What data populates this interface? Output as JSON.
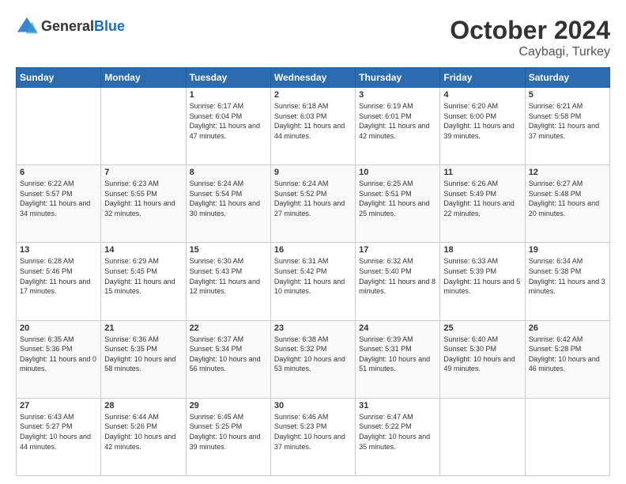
{
  "header": {
    "logo_general": "General",
    "logo_blue": "Blue",
    "month": "October 2024",
    "location": "Caybagi, Turkey"
  },
  "weekdays": [
    "Sunday",
    "Monday",
    "Tuesday",
    "Wednesday",
    "Thursday",
    "Friday",
    "Saturday"
  ],
  "weeks": [
    [
      {
        "day": "",
        "content": ""
      },
      {
        "day": "",
        "content": ""
      },
      {
        "day": "1",
        "sunrise": "Sunrise: 6:17 AM",
        "sunset": "Sunset: 6:04 PM",
        "daylight": "Daylight: 11 hours and 47 minutes."
      },
      {
        "day": "2",
        "sunrise": "Sunrise: 6:18 AM",
        "sunset": "Sunset: 6:03 PM",
        "daylight": "Daylight: 11 hours and 44 minutes."
      },
      {
        "day": "3",
        "sunrise": "Sunrise: 6:19 AM",
        "sunset": "Sunset: 6:01 PM",
        "daylight": "Daylight: 11 hours and 42 minutes."
      },
      {
        "day": "4",
        "sunrise": "Sunrise: 6:20 AM",
        "sunset": "Sunset: 6:00 PM",
        "daylight": "Daylight: 11 hours and 39 minutes."
      },
      {
        "day": "5",
        "sunrise": "Sunrise: 6:21 AM",
        "sunset": "Sunset: 5:58 PM",
        "daylight": "Daylight: 11 hours and 37 minutes."
      }
    ],
    [
      {
        "day": "6",
        "sunrise": "Sunrise: 6:22 AM",
        "sunset": "Sunset: 5:57 PM",
        "daylight": "Daylight: 11 hours and 34 minutes."
      },
      {
        "day": "7",
        "sunrise": "Sunrise: 6:23 AM",
        "sunset": "Sunset: 5:55 PM",
        "daylight": "Daylight: 11 hours and 32 minutes."
      },
      {
        "day": "8",
        "sunrise": "Sunrise: 6:24 AM",
        "sunset": "Sunset: 5:54 PM",
        "daylight": "Daylight: 11 hours and 30 minutes."
      },
      {
        "day": "9",
        "sunrise": "Sunrise: 6:24 AM",
        "sunset": "Sunset: 5:52 PM",
        "daylight": "Daylight: 11 hours and 27 minutes."
      },
      {
        "day": "10",
        "sunrise": "Sunrise: 6:25 AM",
        "sunset": "Sunset: 5:51 PM",
        "daylight": "Daylight: 11 hours and 25 minutes."
      },
      {
        "day": "11",
        "sunrise": "Sunrise: 6:26 AM",
        "sunset": "Sunset: 5:49 PM",
        "daylight": "Daylight: 11 hours and 22 minutes."
      },
      {
        "day": "12",
        "sunrise": "Sunrise: 6:27 AM",
        "sunset": "Sunset: 5:48 PM",
        "daylight": "Daylight: 11 hours and 20 minutes."
      }
    ],
    [
      {
        "day": "13",
        "sunrise": "Sunrise: 6:28 AM",
        "sunset": "Sunset: 5:46 PM",
        "daylight": "Daylight: 11 hours and 17 minutes."
      },
      {
        "day": "14",
        "sunrise": "Sunrise: 6:29 AM",
        "sunset": "Sunset: 5:45 PM",
        "daylight": "Daylight: 11 hours and 15 minutes."
      },
      {
        "day": "15",
        "sunrise": "Sunrise: 6:30 AM",
        "sunset": "Sunset: 5:43 PM",
        "daylight": "Daylight: 11 hours and 12 minutes."
      },
      {
        "day": "16",
        "sunrise": "Sunrise: 6:31 AM",
        "sunset": "Sunset: 5:42 PM",
        "daylight": "Daylight: 11 hours and 10 minutes."
      },
      {
        "day": "17",
        "sunrise": "Sunrise: 6:32 AM",
        "sunset": "Sunset: 5:40 PM",
        "daylight": "Daylight: 11 hours and 8 minutes."
      },
      {
        "day": "18",
        "sunrise": "Sunrise: 6:33 AM",
        "sunset": "Sunset: 5:39 PM",
        "daylight": "Daylight: 11 hours and 5 minutes."
      },
      {
        "day": "19",
        "sunrise": "Sunrise: 6:34 AM",
        "sunset": "Sunset: 5:38 PM",
        "daylight": "Daylight: 11 hours and 3 minutes."
      }
    ],
    [
      {
        "day": "20",
        "sunrise": "Sunrise: 6:35 AM",
        "sunset": "Sunset: 5:36 PM",
        "daylight": "Daylight: 11 hours and 0 minutes."
      },
      {
        "day": "21",
        "sunrise": "Sunrise: 6:36 AM",
        "sunset": "Sunset: 5:35 PM",
        "daylight": "Daylight: 10 hours and 58 minutes."
      },
      {
        "day": "22",
        "sunrise": "Sunrise: 6:37 AM",
        "sunset": "Sunset: 5:34 PM",
        "daylight": "Daylight: 10 hours and 56 minutes."
      },
      {
        "day": "23",
        "sunrise": "Sunrise: 6:38 AM",
        "sunset": "Sunset: 5:32 PM",
        "daylight": "Daylight: 10 hours and 53 minutes."
      },
      {
        "day": "24",
        "sunrise": "Sunrise: 6:39 AM",
        "sunset": "Sunset: 5:31 PM",
        "daylight": "Daylight: 10 hours and 51 minutes."
      },
      {
        "day": "25",
        "sunrise": "Sunrise: 6:40 AM",
        "sunset": "Sunset: 5:30 PM",
        "daylight": "Daylight: 10 hours and 49 minutes."
      },
      {
        "day": "26",
        "sunrise": "Sunrise: 6:42 AM",
        "sunset": "Sunset: 5:28 PM",
        "daylight": "Daylight: 10 hours and 46 minutes."
      }
    ],
    [
      {
        "day": "27",
        "sunrise": "Sunrise: 6:43 AM",
        "sunset": "Sunset: 5:27 PM",
        "daylight": "Daylight: 10 hours and 44 minutes."
      },
      {
        "day": "28",
        "sunrise": "Sunrise: 6:44 AM",
        "sunset": "Sunset: 5:26 PM",
        "daylight": "Daylight: 10 hours and 42 minutes."
      },
      {
        "day": "29",
        "sunrise": "Sunrise: 6:45 AM",
        "sunset": "Sunset: 5:25 PM",
        "daylight": "Daylight: 10 hours and 39 minutes."
      },
      {
        "day": "30",
        "sunrise": "Sunrise: 6:46 AM",
        "sunset": "Sunset: 5:23 PM",
        "daylight": "Daylight: 10 hours and 37 minutes."
      },
      {
        "day": "31",
        "sunrise": "Sunrise: 6:47 AM",
        "sunset": "Sunset: 5:22 PM",
        "daylight": "Daylight: 10 hours and 35 minutes."
      },
      {
        "day": "",
        "content": ""
      },
      {
        "day": "",
        "content": ""
      }
    ]
  ]
}
